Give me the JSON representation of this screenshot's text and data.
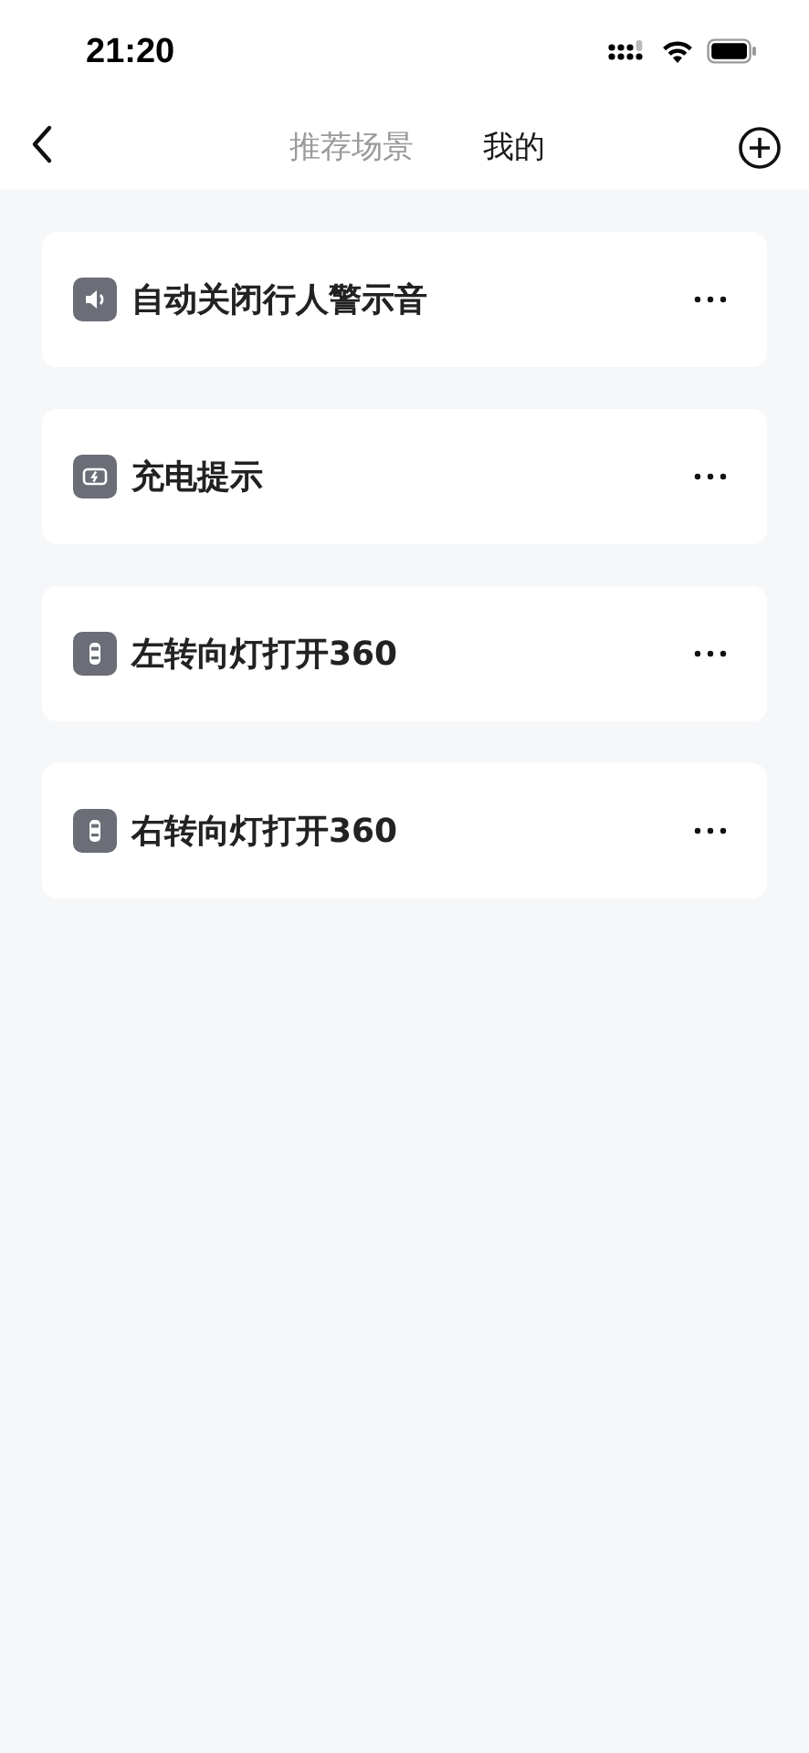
{
  "status_bar": {
    "time": "21:20"
  },
  "tabs": [
    {
      "label": "推荐场景",
      "selected": false
    },
    {
      "label": "我的",
      "selected": true
    }
  ],
  "scenes": [
    {
      "title": "自动关闭行人警示音",
      "kind": "speaker"
    },
    {
      "title": "充电提示",
      "kind": "charging"
    },
    {
      "title": "左转向灯打开360",
      "kind": "car"
    },
    {
      "title": "右转向灯打开360",
      "kind": "car"
    }
  ]
}
